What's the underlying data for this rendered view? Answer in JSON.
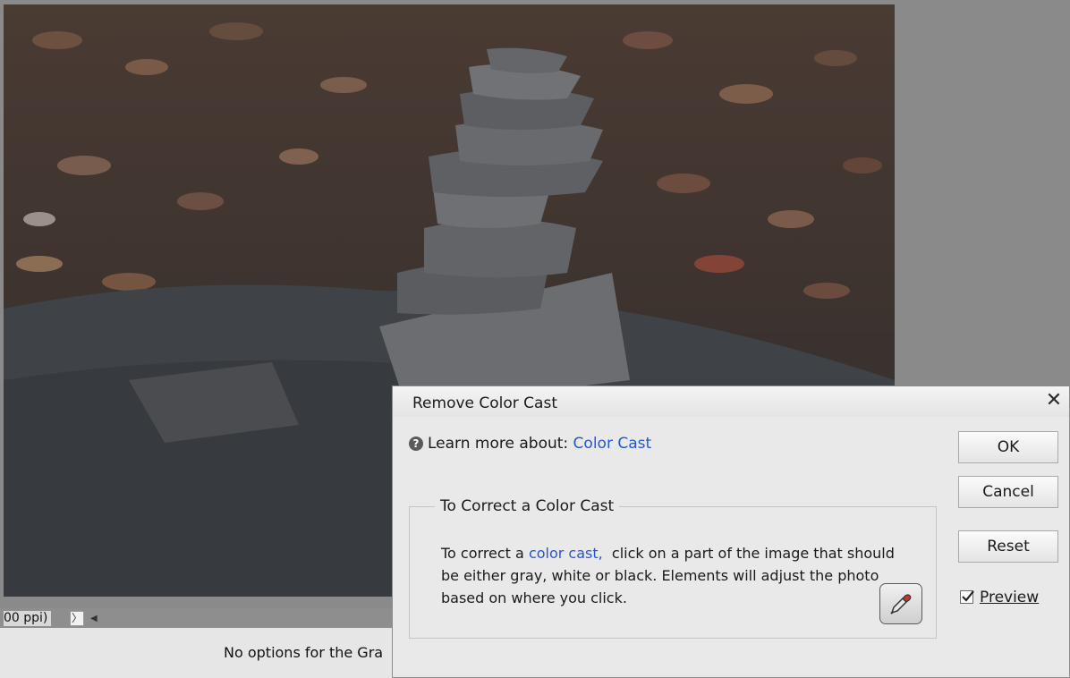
{
  "status": {
    "zoom_text": "00 ppi)",
    "nav_right_glyph": "〉",
    "nav_left_glyph": "◀"
  },
  "options_bar": {
    "text": "No options for the Gra"
  },
  "dialog": {
    "title": "Remove Color Cast",
    "close_glyph": "✕",
    "help_prefix": "Learn more about:",
    "help_link": "Color Cast",
    "group_title": "To Correct a Color Cast",
    "instructions_prefix": "To correct a ",
    "instructions_link": "color cast,",
    "instructions_suffix": "  click on a part of the image that should be either gray, white or black. Elements will adjust the photo based on where you click.",
    "ok_label": "OK",
    "cancel_label": "Cancel",
    "reset_label": "Reset",
    "preview_label": "Preview",
    "preview_checked": true
  },
  "colors": {
    "link": "#2457d6",
    "canvas_bg": "#8a8a8a",
    "dialog_bg": "#e9e9e9"
  },
  "icons": {
    "help": "question-circle-icon",
    "close": "close-icon",
    "eyedropper": "eyedropper-icon",
    "checkbox": "checkmark-icon"
  }
}
